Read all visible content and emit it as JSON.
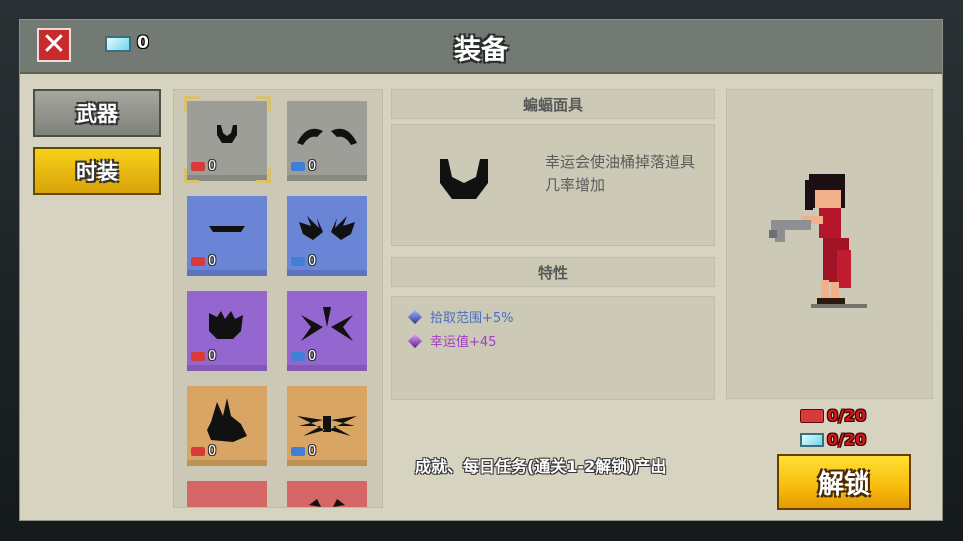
{
  "header": {
    "title": "装备",
    "ticket_count": "0"
  },
  "tabs": [
    {
      "label": "武器"
    },
    {
      "label": "时装"
    }
  ],
  "grid": {
    "items": [
      {
        "name": "bat-mask",
        "rarity": "gray",
        "count": "0",
        "piece": "red"
      },
      {
        "name": "bat-wings",
        "rarity": "gray",
        "count": "0",
        "piece": "blue"
      },
      {
        "name": "mustache",
        "rarity": "blue",
        "count": "0",
        "piece": "red"
      },
      {
        "name": "spiky-wings",
        "rarity": "blue",
        "count": "0",
        "piece": "blue"
      },
      {
        "name": "purple-ears",
        "rarity": "purple",
        "count": "0",
        "piece": "red"
      },
      {
        "name": "purple-wings",
        "rarity": "purple",
        "count": "0",
        "piece": "blue"
      },
      {
        "name": "bunny-ears",
        "rarity": "orange",
        "count": "0",
        "piece": "red"
      },
      {
        "name": "feather-wings",
        "rarity": "orange",
        "count": "0",
        "piece": "blue"
      },
      {
        "name": "red-item-1",
        "rarity": "red",
        "count": "",
        "piece": "red"
      },
      {
        "name": "red-item-2",
        "rarity": "red",
        "count": "",
        "piece": "blue"
      }
    ]
  },
  "detail": {
    "name": "蝙蝠面具",
    "description": "幸运会使油桶掉落道具几率增加",
    "traits_header": "特性",
    "traits": [
      {
        "text": "拾取范围+5%",
        "color": "#4a6fc2"
      },
      {
        "text": "幸运值+45",
        "color": "#a040c0"
      }
    ]
  },
  "costs": [
    {
      "type": "piece",
      "text": "0/20"
    },
    {
      "type": "ticket",
      "text": "0/20"
    }
  ],
  "source_text": "成就、每日任务(通关1-2解锁)产出",
  "unlock_label": "解锁",
  "colors": {
    "piece_red": "#d83a3a",
    "piece_blue": "#3f7fd8",
    "accent_yellow": "#f8c20c"
  }
}
